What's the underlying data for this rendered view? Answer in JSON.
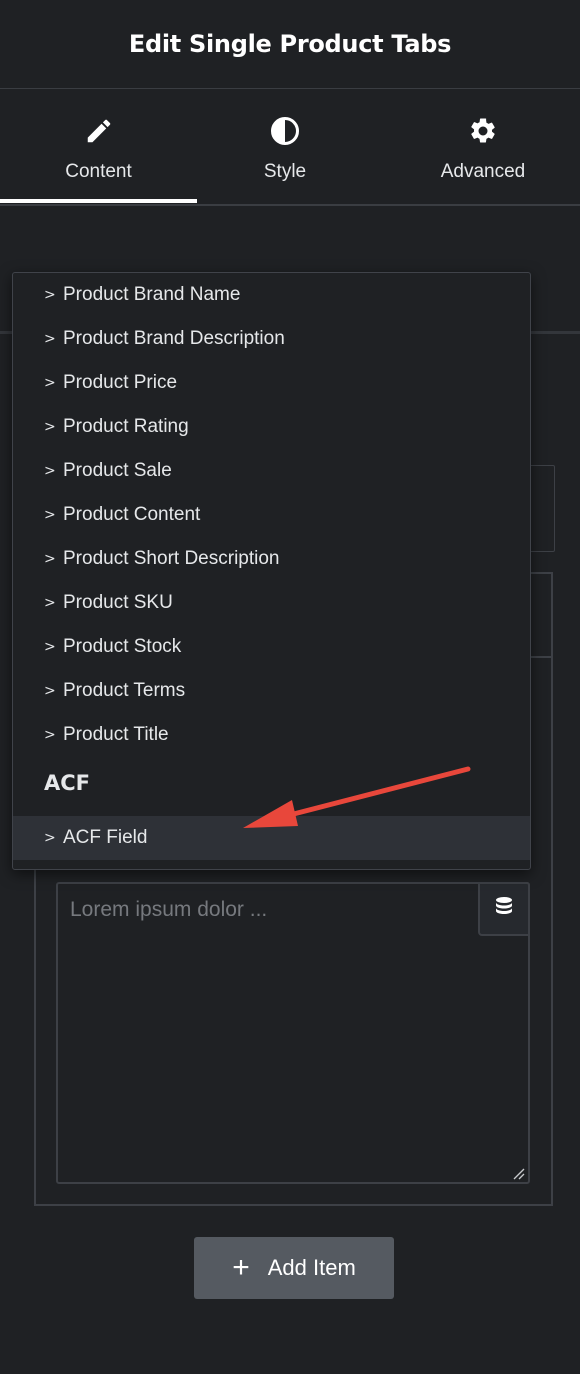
{
  "header": {
    "title": "Edit Single Product Tabs"
  },
  "tabs": [
    {
      "label": "Content",
      "icon": "pencil-icon",
      "active": true
    },
    {
      "label": "Style",
      "icon": "contrast-icon",
      "active": false
    },
    {
      "label": "Advanced",
      "icon": "gear-icon",
      "active": false
    }
  ],
  "dropdown": {
    "items": [
      "Product Brand Name",
      "Product Brand Description",
      "Product Price",
      "Product Rating",
      "Product Sale",
      "Product Content",
      "Product Short Description",
      "Product SKU",
      "Product Stock",
      "Product Terms",
      "Product Title"
    ],
    "group_acf": "ACF",
    "acf_items": [
      "ACF Field"
    ],
    "chevron": ">"
  },
  "editor": {
    "placeholder": "Lorem ipsum dolor ..."
  },
  "add_item": {
    "label": "Add Item",
    "plus": "+"
  },
  "colors": {
    "background": "#26292e",
    "panel": "#1f2124",
    "highlight": "#2e3137",
    "button": "#555a61",
    "annotation_arrow": "#e8473b"
  }
}
